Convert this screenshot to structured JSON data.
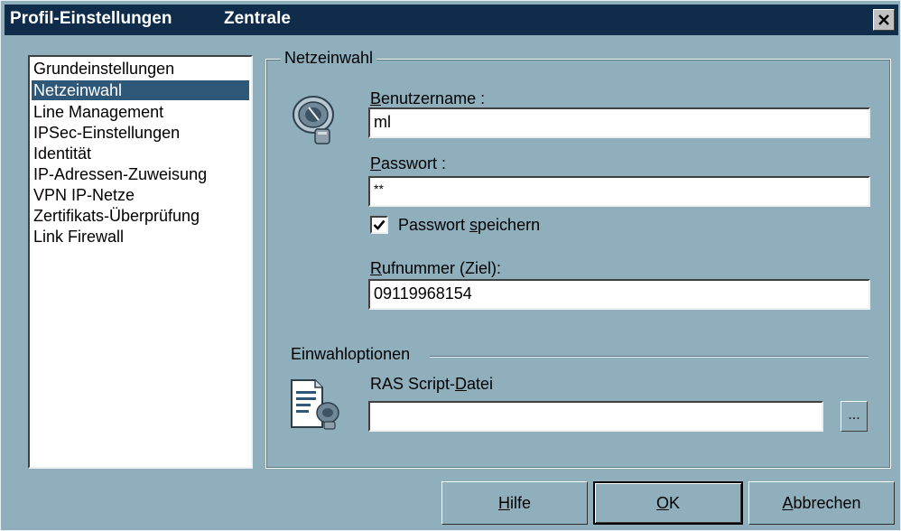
{
  "window": {
    "title": "Profil-Einstellungen",
    "profile_name": "Zentrale",
    "close_label": "×",
    "colors": {
      "titlebar": "#0f2d4a",
      "background": "#8fafbd",
      "selection": "#2f5878"
    }
  },
  "sidebar": {
    "items": [
      {
        "label": "Grundeinstellungen"
      },
      {
        "label": "Netzeinwahl",
        "selected": true
      },
      {
        "label": "Line Management"
      },
      {
        "label": "IPSec-Einstellungen"
      },
      {
        "label": "Identität"
      },
      {
        "label": "IP-Adressen-Zuweisung"
      },
      {
        "label": "VPN IP-Netze"
      },
      {
        "label": "Zertifikats-Überprüfung"
      },
      {
        "label": "Link Firewall"
      }
    ]
  },
  "section": {
    "title": "Netzeinwahl",
    "icon": "phone-dialer-icon",
    "username": {
      "label_ul": "B",
      "label_rest": "enutzername :",
      "value": "ml"
    },
    "password": {
      "label_ul": "P",
      "label_rest": "asswort :",
      "value": "**"
    },
    "save_password": {
      "label_pre": "Passwort ",
      "label_ul": "s",
      "label_rest": "peichern",
      "checked": true
    },
    "phone": {
      "label_ul": "R",
      "label_rest": "ufnummer (Ziel):",
      "value": "09119968154"
    }
  },
  "dial_options": {
    "title": "Einwahloptionen",
    "icon": "script-file-icon",
    "script": {
      "label_pre": "RAS Script-",
      "label_ul": "D",
      "label_rest": "atei",
      "value": "",
      "browse_label": "..."
    }
  },
  "buttons": {
    "help": {
      "ul": "H",
      "rest": "ilfe"
    },
    "ok": {
      "ul": "O",
      "rest": "K"
    },
    "cancel": {
      "ul": "A",
      "rest": "bbrechen"
    }
  }
}
